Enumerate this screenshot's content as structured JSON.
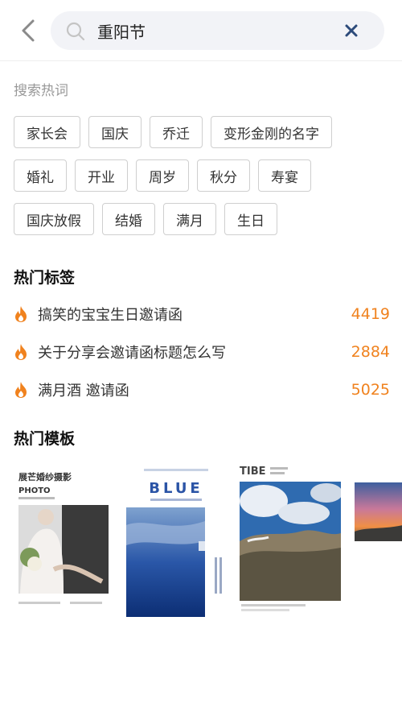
{
  "search": {
    "query": "重阳节"
  },
  "hot_keywords": {
    "label": "搜索热词",
    "rows": [
      [
        "家长会",
        "国庆",
        "乔迁",
        "变形金刚的名字"
      ],
      [
        "婚礼",
        "开业",
        "周岁",
        "秋分",
        "寿宴"
      ],
      [
        "国庆放假",
        "结婚",
        "满月",
        "生日"
      ]
    ]
  },
  "hot_tags": {
    "title": "热门标签",
    "items": [
      {
        "text": "搞笑的宝宝生日邀请函",
        "count": "4419"
      },
      {
        "text": "关于分享会邀请函标题怎么写",
        "count": "2884"
      },
      {
        "text": "满月酒 邀请函",
        "count": "5025"
      }
    ]
  },
  "hot_templates": {
    "title": "热门模板",
    "cards": [
      {
        "title": "展芒婚纱摄影",
        "subtitle": "PHOTO"
      },
      {
        "title": "BLUE"
      },
      {
        "title": "TIBE"
      }
    ]
  },
  "colors": {
    "accent": "#f0821e",
    "search_bg": "#f2f3f7",
    "clear": "#2c4a7a"
  }
}
